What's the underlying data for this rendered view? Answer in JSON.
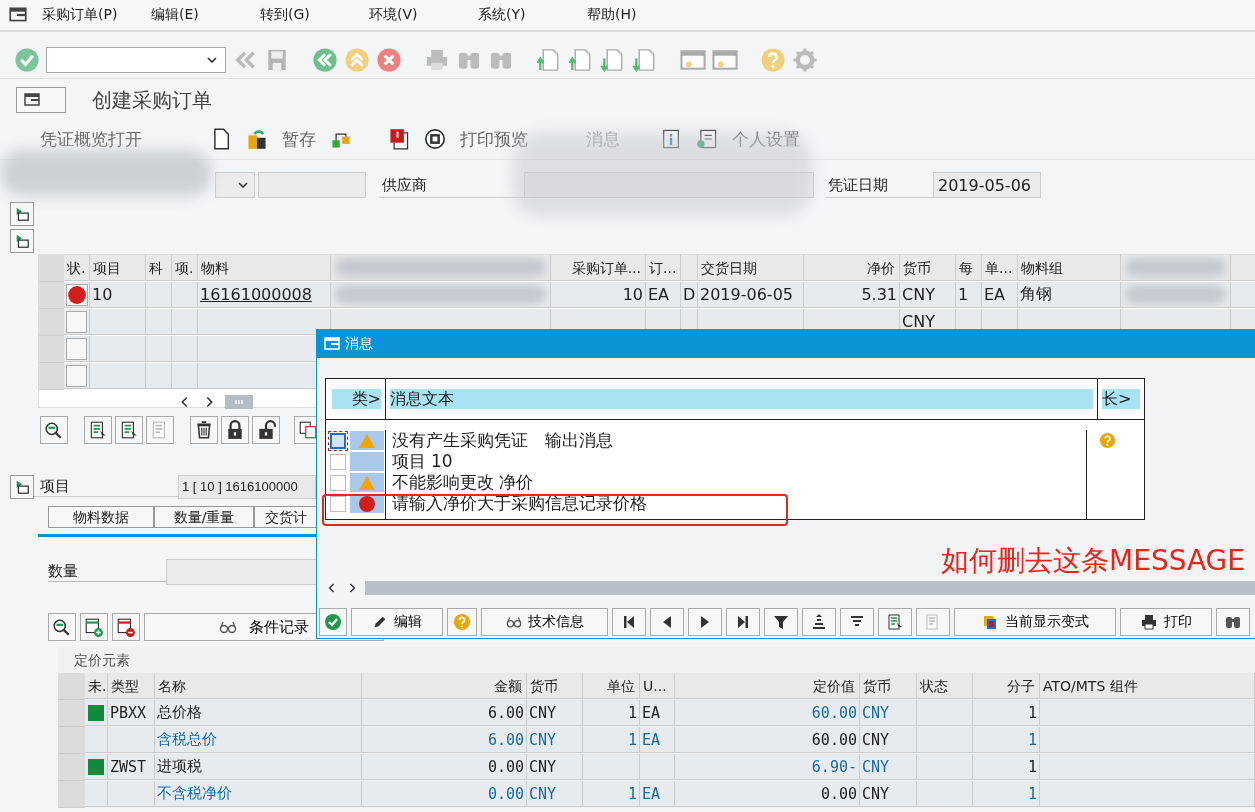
{
  "menu_bar": [
    {
      "label": "采购订单(P)"
    },
    {
      "label": "编辑(E)"
    },
    {
      "label": "转到(G)"
    },
    {
      "label": "环境(V)"
    },
    {
      "label": "系统(Y)"
    },
    {
      "label": "帮助(H)"
    }
  ],
  "title": "创建采购订单",
  "app_toolbar": [
    "凭证概览打开",
    "暂存",
    "打印预览",
    "消息",
    "个人设置"
  ],
  "header": {
    "vendor_label": "供应商",
    "date_label": "凭证日期",
    "date_value": "2019-05-06"
  },
  "items_table": {
    "columns": [
      "状.",
      "项目",
      "科",
      "项.",
      "物料",
      null,
      "采购订单...",
      "订...",
      null,
      "交货日期",
      "净价",
      "货币",
      "每",
      "单...",
      "物料组",
      null,
      null
    ],
    "rows": [
      {
        "error": true,
        "cells": [
          null,
          "10",
          null,
          null,
          "16161000008",
          null,
          "10",
          "EA",
          "D",
          "2019-06-05",
          "5.31",
          "CNY",
          "1",
          "EA",
          "角钢",
          null,
          null
        ]
      },
      {
        "error": false,
        "cells": [
          null,
          null,
          null,
          null,
          null,
          null,
          null,
          null,
          null,
          null,
          null,
          "CNY",
          null,
          null,
          null,
          null,
          null
        ]
      },
      {
        "error": false,
        "cells": [
          null,
          null,
          null,
          null,
          null,
          null,
          null,
          null,
          null,
          null,
          null,
          null,
          null,
          null,
          null,
          null,
          null
        ]
      },
      {
        "error": false,
        "cells": [
          null,
          null,
          null,
          null,
          null,
          null,
          null,
          null,
          null,
          null,
          null,
          null,
          null,
          null,
          null,
          null,
          null
        ]
      }
    ]
  },
  "item_detail": {
    "label": "项目",
    "value": "1 [ 10 ] 1616100000",
    "tabs": [
      {
        "label": "物料数据"
      },
      {
        "label": "数量/重量"
      },
      {
        "label": "交货计"
      }
    ],
    "quantity_label": "数量",
    "conditions_button": "条件记录"
  },
  "pricing": {
    "title": "定价元素",
    "columns": [
      "未.",
      "类型",
      "名称",
      "金额",
      "货币",
      "单位",
      "U...",
      "定价值",
      "货币",
      "状态",
      "分子",
      "ATO/MTS 组件"
    ],
    "rows": [
      {
        "marker": true,
        "cells": [
          null,
          {
            "text": "PBXX",
            "linked": false
          },
          {
            "text": "总价格",
            "linked": false
          },
          {
            "text": "6.00",
            "linked": false
          },
          {
            "text": "CNY",
            "linked": false
          },
          {
            "text": "1",
            "linked": false
          },
          {
            "text": "EA",
            "linked": false
          },
          {
            "text": "60.00",
            "linked": true
          },
          {
            "text": "CNY",
            "linked": true
          },
          null,
          {
            "text": "1",
            "linked": false
          },
          null
        ]
      },
      {
        "marker": false,
        "cells": [
          null,
          null,
          {
            "text": "含税总价",
            "linked": true
          },
          {
            "text": "6.00",
            "linked": true
          },
          {
            "text": "CNY",
            "linked": true
          },
          {
            "text": "1",
            "linked": true
          },
          {
            "text": "EA",
            "linked": true
          },
          {
            "text": "60.00",
            "linked": false
          },
          {
            "text": "CNY",
            "linked": false
          },
          null,
          {
            "text": "1",
            "linked": true
          },
          null
        ]
      },
      {
        "marker": true,
        "cells": [
          null,
          {
            "text": "ZWST",
            "linked": false
          },
          {
            "text": "进项税",
            "linked": false
          },
          {
            "text": "0.00",
            "linked": false
          },
          {
            "text": "CNY",
            "linked": false
          },
          null,
          null,
          {
            "text": "6.90-",
            "linked": true
          },
          {
            "text": "CNY",
            "linked": true
          },
          null,
          {
            "text": "1",
            "linked": false
          },
          null
        ]
      },
      {
        "marker": false,
        "cells": [
          null,
          null,
          {
            "text": "不含税净价",
            "linked": true
          },
          {
            "text": "0.00",
            "linked": true
          },
          {
            "text": "CNY",
            "linked": true
          },
          {
            "text": "1",
            "linked": true
          },
          {
            "text": "EA",
            "linked": true
          },
          {
            "text": "0.00",
            "linked": false
          },
          {
            "text": "CNY",
            "linked": false
          },
          null,
          {
            "text": "1",
            "linked": true
          },
          null
        ]
      }
    ]
  },
  "popup": {
    "title": "消息",
    "columns": [
      "类>",
      "消息文本",
      "长>"
    ],
    "rows": [
      {
        "warning": true,
        "error": false,
        "text": "没有产生采购凭证　输出消息",
        "focused": true,
        "long_text": true
      },
      {
        "warning": false,
        "error": false,
        "text": "项目 10",
        "focused": false,
        "long_text": false
      },
      {
        "warning": true,
        "error": false,
        "text": "不能影响更改 净价",
        "focused": false,
        "long_text": false
      },
      {
        "warning": false,
        "error": true,
        "text": "请输入净价大于采购信息记录价格",
        "focused": false,
        "long_text": false
      }
    ],
    "annotation": "如何删去这条MESSAGE",
    "toolbar": [
      "编辑",
      "技术信息",
      "当前显示变式",
      "打印"
    ]
  }
}
